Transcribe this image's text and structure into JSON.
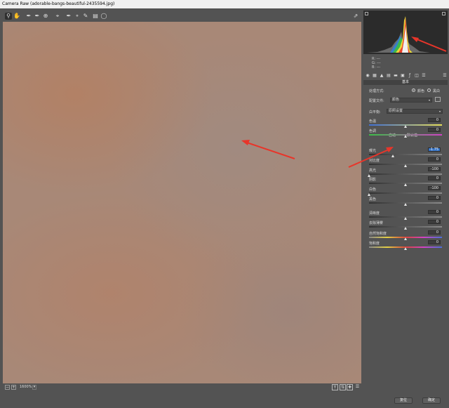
{
  "window": {
    "title": "Camera Raw (adorable-bangs-beautiful-2435594.jpg)"
  },
  "toolbar": {
    "tools": [
      "zoom-icon",
      "hand-icon",
      "white-balance-eyedropper-icon",
      "color-sampler-icon",
      "target-adjust-icon",
      "crop-icon",
      "straighten-icon",
      "spot-removal-icon",
      "red-eye-icon",
      "adjustment-brush-icon",
      "graduated-filter-icon",
      "radial-filter-icon"
    ],
    "fullscreen_icon": "fullscreen-toggle-icon"
  },
  "histogram": {
    "rgb_r": "R:",
    "rgb_g": "G:",
    "rgb_b": "B:",
    "rgb_value": "---"
  },
  "panel": {
    "section_title": "基本",
    "treatment_label": "处理方式:",
    "treatment_color": "颜色",
    "treatment_bw": "黑白",
    "profile_label": "配置文件:",
    "profile_value": "颜色",
    "wb_label": "白平衡:",
    "wb_value": "原照设置",
    "auto_label": "自动",
    "default_label": "默认值",
    "sliders": [
      {
        "label": "色温",
        "value": "0",
        "pos": 0.5,
        "track": "temp"
      },
      {
        "label": "色调",
        "value": "0",
        "pos": 0.5,
        "track": "tint"
      },
      {
        "label": "曝光",
        "value": "-1.75",
        "pos": 0.33,
        "track": "plain",
        "highlight": true
      },
      {
        "label": "对比度",
        "value": "0",
        "pos": 0.5,
        "track": "plain"
      },
      {
        "label": "高光",
        "value": "-100",
        "pos": 0.0,
        "track": "plain"
      },
      {
        "label": "阴影",
        "value": "0",
        "pos": 0.5,
        "track": "plain"
      },
      {
        "label": "白色",
        "value": "-100",
        "pos": 0.0,
        "track": "plain"
      },
      {
        "label": "黑色",
        "value": "0",
        "pos": 0.5,
        "track": "plain"
      },
      {
        "label": "清晰度",
        "value": "0",
        "pos": 0.5,
        "track": "plain"
      },
      {
        "label": "去除薄雾",
        "value": "0",
        "pos": 0.5,
        "track": "plain"
      },
      {
        "label": "自然饱和度",
        "value": "0",
        "pos": 0.5,
        "track": "sat"
      },
      {
        "label": "饱和度",
        "value": "0",
        "pos": 0.5,
        "track": "sat"
      }
    ]
  },
  "status": {
    "zoom": "1600%"
  },
  "footer": {
    "reset_label": "复位",
    "ok_label": "确定"
  },
  "colors": {
    "background": "#535353",
    "annotation_arrow": "#e8352a",
    "highlight": "#2f6fc4"
  }
}
